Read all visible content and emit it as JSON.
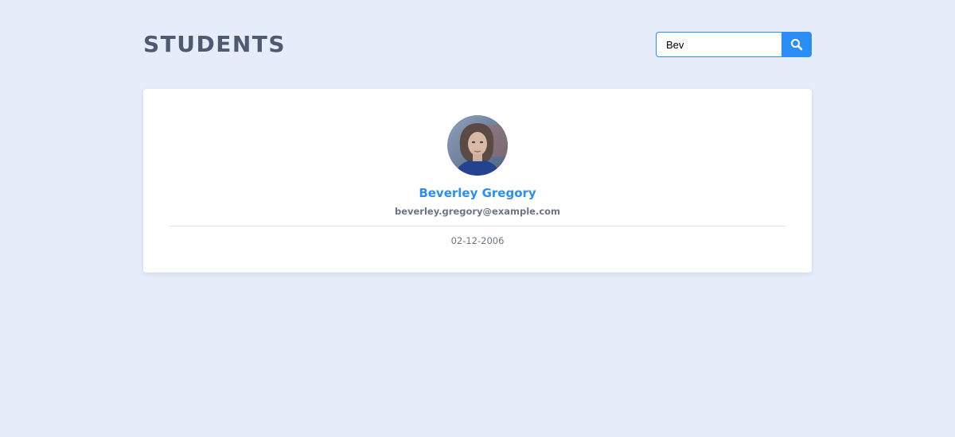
{
  "header": {
    "title": "STUDENTS"
  },
  "search": {
    "value": "Bev",
    "button_icon": "search-icon"
  },
  "student": {
    "name": "Beverley Gregory",
    "email": "beverley.gregory@example.com",
    "date": "02-12-2006",
    "avatar_icon": "student-photo"
  },
  "colors": {
    "background": "#e5edfa",
    "accent": "#2b8ef6",
    "title": "#4f5a70"
  }
}
